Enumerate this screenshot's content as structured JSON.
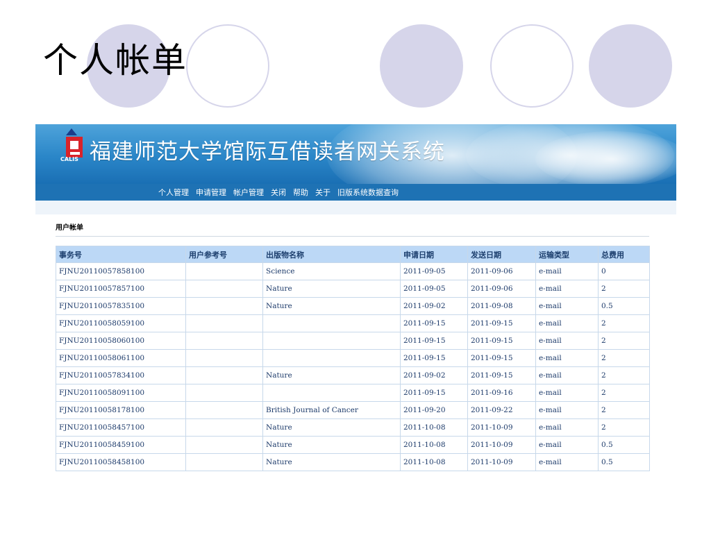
{
  "slide_title": "个人帐单",
  "app": {
    "logo_text": "CALIS",
    "title": "福建师范大学馆际互借读者网关系统",
    "nav": [
      "个人管理",
      "申请管理",
      "帐户管理",
      "关闭",
      "帮助",
      "关于",
      "旧版系统数据查询"
    ]
  },
  "section_title": "用户帐单",
  "table": {
    "headers": [
      "事务号",
      "用户参考号",
      "出版物名称",
      "申请日期",
      "发送日期",
      "运输类型",
      "总费用"
    ],
    "rows": [
      [
        "FJNU20110057858100",
        "",
        "Science",
        "2011-09-05",
        "2011-09-06",
        "e-mail",
        "0"
      ],
      [
        "FJNU20110057857100",
        "",
        "Nature",
        "2011-09-05",
        "2011-09-06",
        "e-mail",
        "2"
      ],
      [
        "FJNU20110057835100",
        "",
        "Nature",
        "2011-09-02",
        "2011-09-08",
        "e-mail",
        "0.5"
      ],
      [
        "FJNU20110058059100",
        "",
        "",
        "2011-09-15",
        "2011-09-15",
        "e-mail",
        "2"
      ],
      [
        "FJNU20110058060100",
        "",
        "",
        "2011-09-15",
        "2011-09-15",
        "e-mail",
        "2"
      ],
      [
        "FJNU20110058061100",
        "",
        "",
        "2011-09-15",
        "2011-09-15",
        "e-mail",
        "2"
      ],
      [
        "FJNU20110057834100",
        "",
        "Nature",
        "2011-09-02",
        "2011-09-15",
        "e-mail",
        "2"
      ],
      [
        "FJNU20110058091100",
        "",
        "",
        "2011-09-15",
        "2011-09-16",
        "e-mail",
        "2"
      ],
      [
        "FJNU20110058178100",
        "",
        "British Journal of Cancer",
        "2011-09-20",
        "2011-09-22",
        "e-mail",
        "2"
      ],
      [
        "FJNU20110058457100",
        "",
        "Nature",
        "2011-10-08",
        "2011-10-09",
        "e-mail",
        "2"
      ],
      [
        "FJNU20110058459100",
        "",
        "Nature",
        "2011-10-08",
        "2011-10-09",
        "e-mail",
        "0.5"
      ],
      [
        "FJNU20110058458100",
        "",
        "Nature",
        "2011-10-08",
        "2011-10-09",
        "e-mail",
        "0.5"
      ]
    ]
  },
  "colors": {
    "circle_fill": "#d6d5ea",
    "banner_blue": "#2a86c8",
    "nav_blue": "#1e72b4",
    "header_blue": "#bcd8f6",
    "logo_red": "#d8232a"
  }
}
